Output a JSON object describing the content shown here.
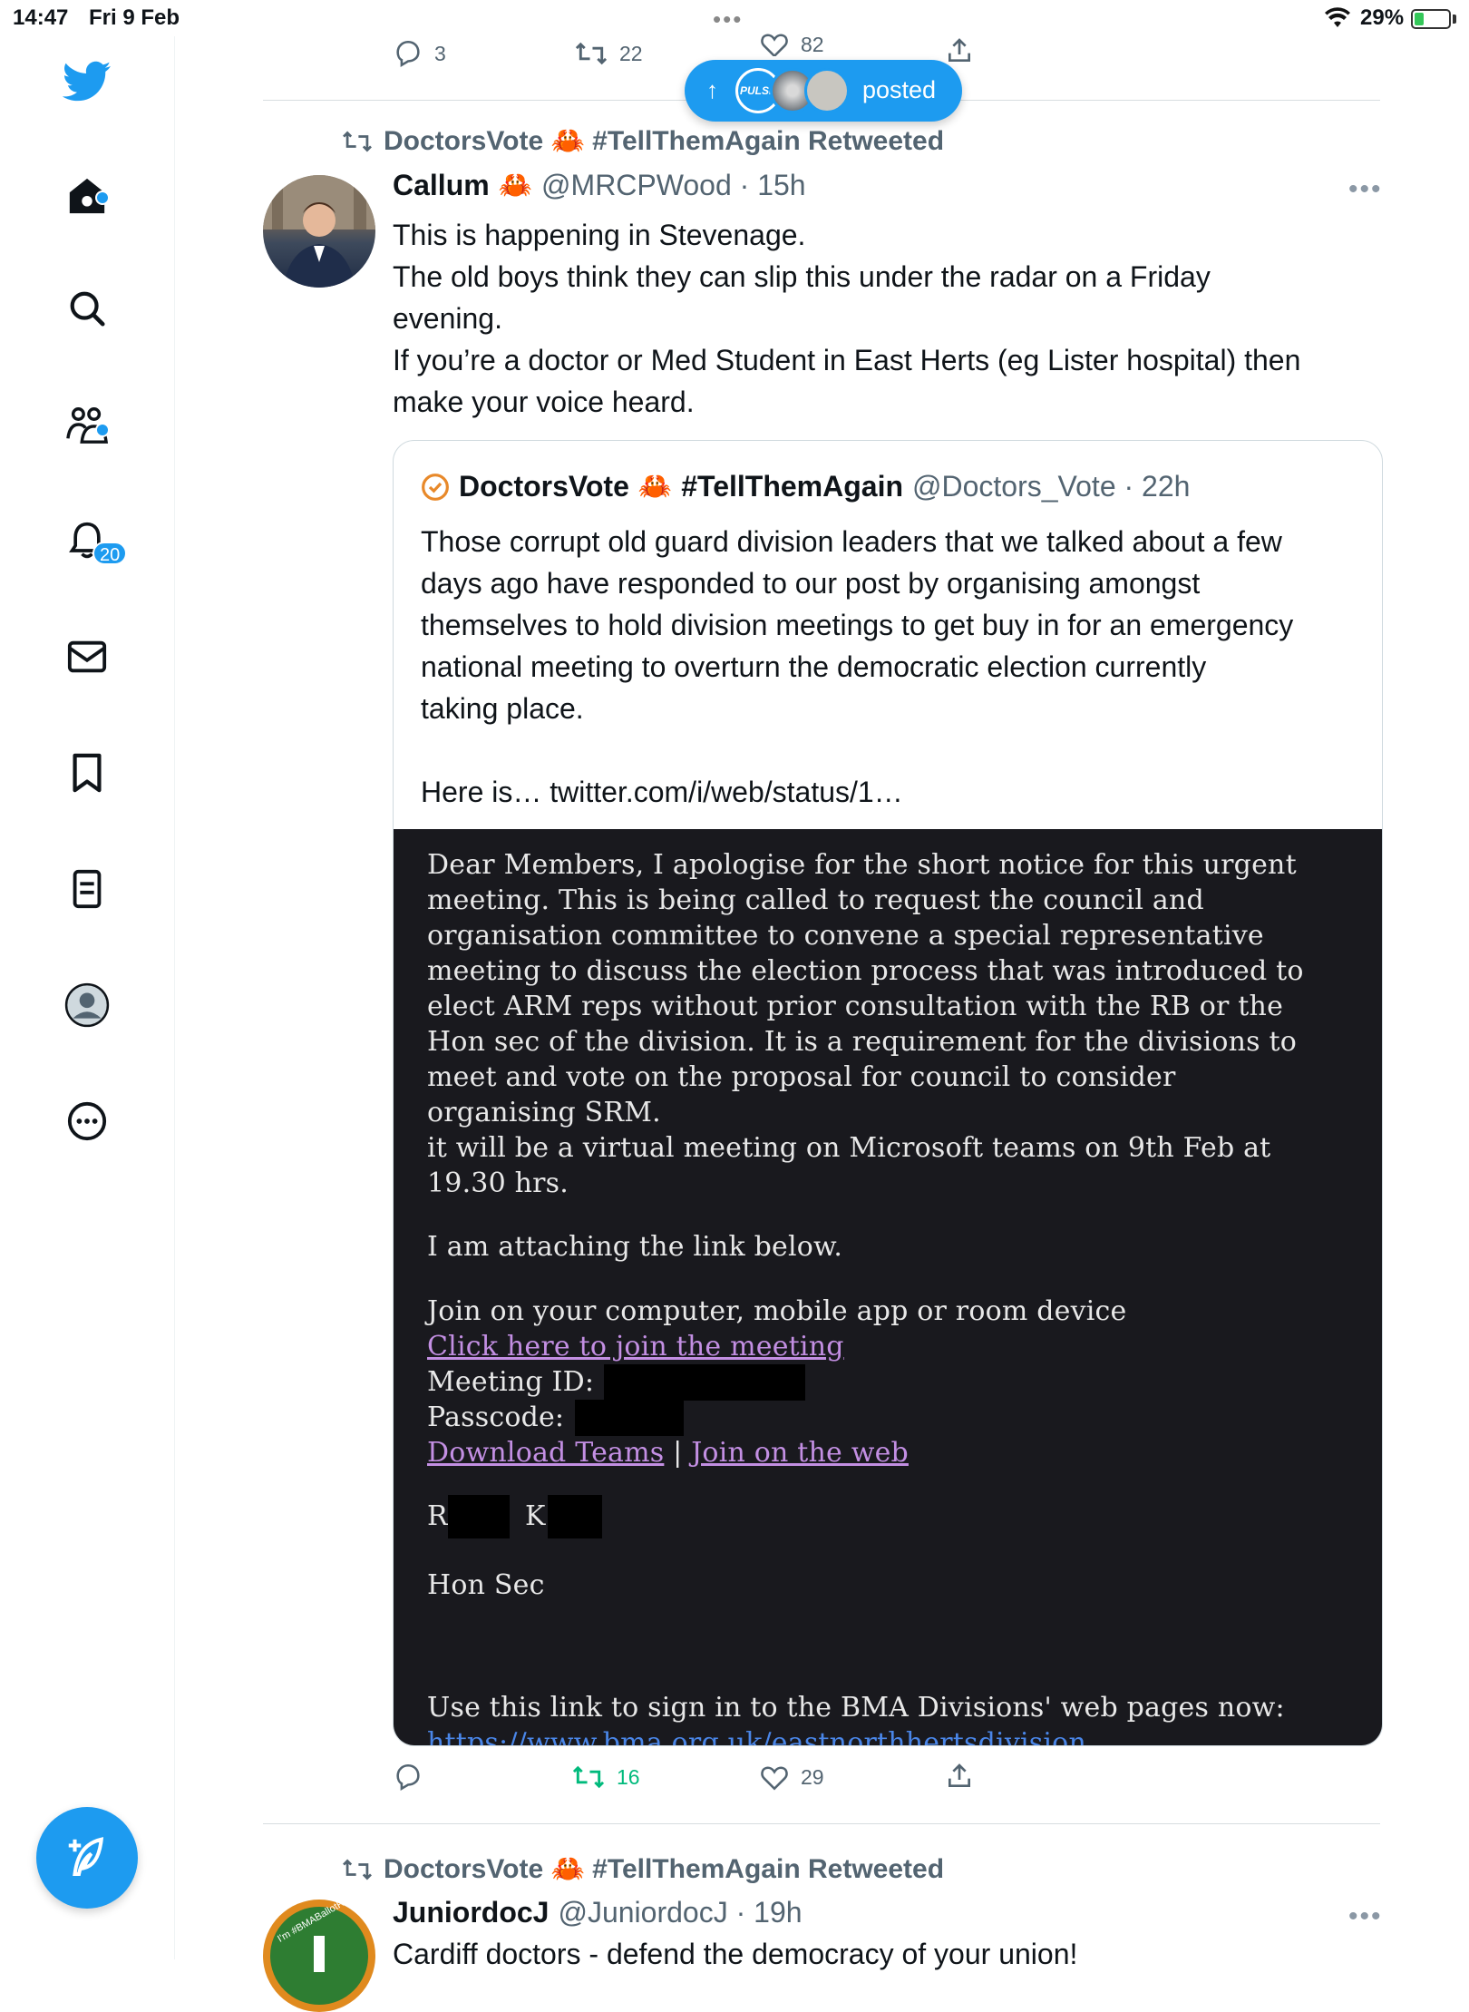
{
  "status_bar": {
    "time": "14:47",
    "date": "Fri 9 Feb",
    "battery": "29%",
    "battery_level": 0.29
  },
  "sidebar": {
    "notifications_badge": "20"
  },
  "top_actions": {
    "reply_count": "3",
    "retweet_count": "22",
    "like_count": "82"
  },
  "new_posts_pill": {
    "label": "posted",
    "avatar1_text": "PULSE"
  },
  "tweet1": {
    "retweeted_by": "DoctorsVote 🦀 #TellThemAgain Retweeted",
    "author_name": "Callum",
    "emoji": "🦀",
    "handle_time": "@MRCPWood · 15h",
    "lines": [
      "This is happening in Stevenage.",
      "The old boys think they can slip this under the radar on a Friday",
      "evening.",
      "If you’re a doctor or Med Student in East Herts (eg Lister hospital) then",
      "make your voice heard."
    ],
    "quote": {
      "author_name": "DoctorsVote",
      "emoji": "🦀",
      "hashtag": "#TellThemAgain",
      "handle_time": "@Doctors_Vote · 22h",
      "lines": [
        "Those corrupt old guard division leaders that we talked about a few",
        "days ago have responded to our post by organising amongst",
        "themselves to hold division meetings to get buy in for an emergency",
        "national meeting to overturn the democratic election currently",
        "taking place.",
        "",
        "Here is… twitter.com/i/web/status/1…"
      ],
      "image_lines": [
        " Dear Members, I apologise for the short notice for this urgent",
        "meeting. This is being called to request the council and",
        "organisation committee to convene a special representative",
        "meeting to discuss the election process that was introduced to",
        "elect ARM reps without prior consultation with the RB or the",
        "Hon sec of the division. It is a requirement for the divisions to",
        "meet and vote on the proposal for council to consider",
        "organising SRM.",
        "it will be a virtual meeting on Microsoft teams on 9th Feb at",
        "19.30 hrs."
      ],
      "image_attach": "I am attaching the link below.",
      "image_join": " Join on your computer, mobile app or room device",
      "image_click": "Click here to join the meeting",
      "image_meeting_id": "Meeting ID: ",
      "image_passcode": "Passcode:",
      "image_download": "Download Teams",
      "image_sep": "|",
      "image_join_web": "Join on the web",
      "image_sig_r": "R",
      "image_sig_k": "K",
      "image_hon_sec": "Hon Sec",
      "image_bma": "Use this link to sign in to the BMA Divisions' web pages now:",
      "image_url": "https://www.bma.org.uk/eastnorthhertsdivision"
    },
    "actions": {
      "retweets": "16",
      "likes": "29"
    }
  },
  "tweet2": {
    "retweeted_by": "DoctorsVote 🦀 #TellThemAgain Retweeted",
    "author_name": "JuniordocJ",
    "handle_time": "@JuniordocJ · 19h",
    "text": "Cardiff doctors - defend the democracy of your union!",
    "avatar_text": "I'm #BMABallotReady"
  },
  "colors": {
    "accent": "#1d9bf0",
    "retweet_green": "#00ba7c",
    "muted": "#536471"
  },
  "icons": [
    "twitter-logo-icon",
    "home-icon",
    "search-icon",
    "communities-icon",
    "bell-icon",
    "mail-icon",
    "bookmark-icon",
    "lists-icon",
    "profile-icon",
    "more-circle-icon",
    "compose-icon",
    "reply-icon",
    "retweet-icon",
    "heart-icon",
    "share-icon",
    "verified-icon",
    "crab-icon"
  ]
}
